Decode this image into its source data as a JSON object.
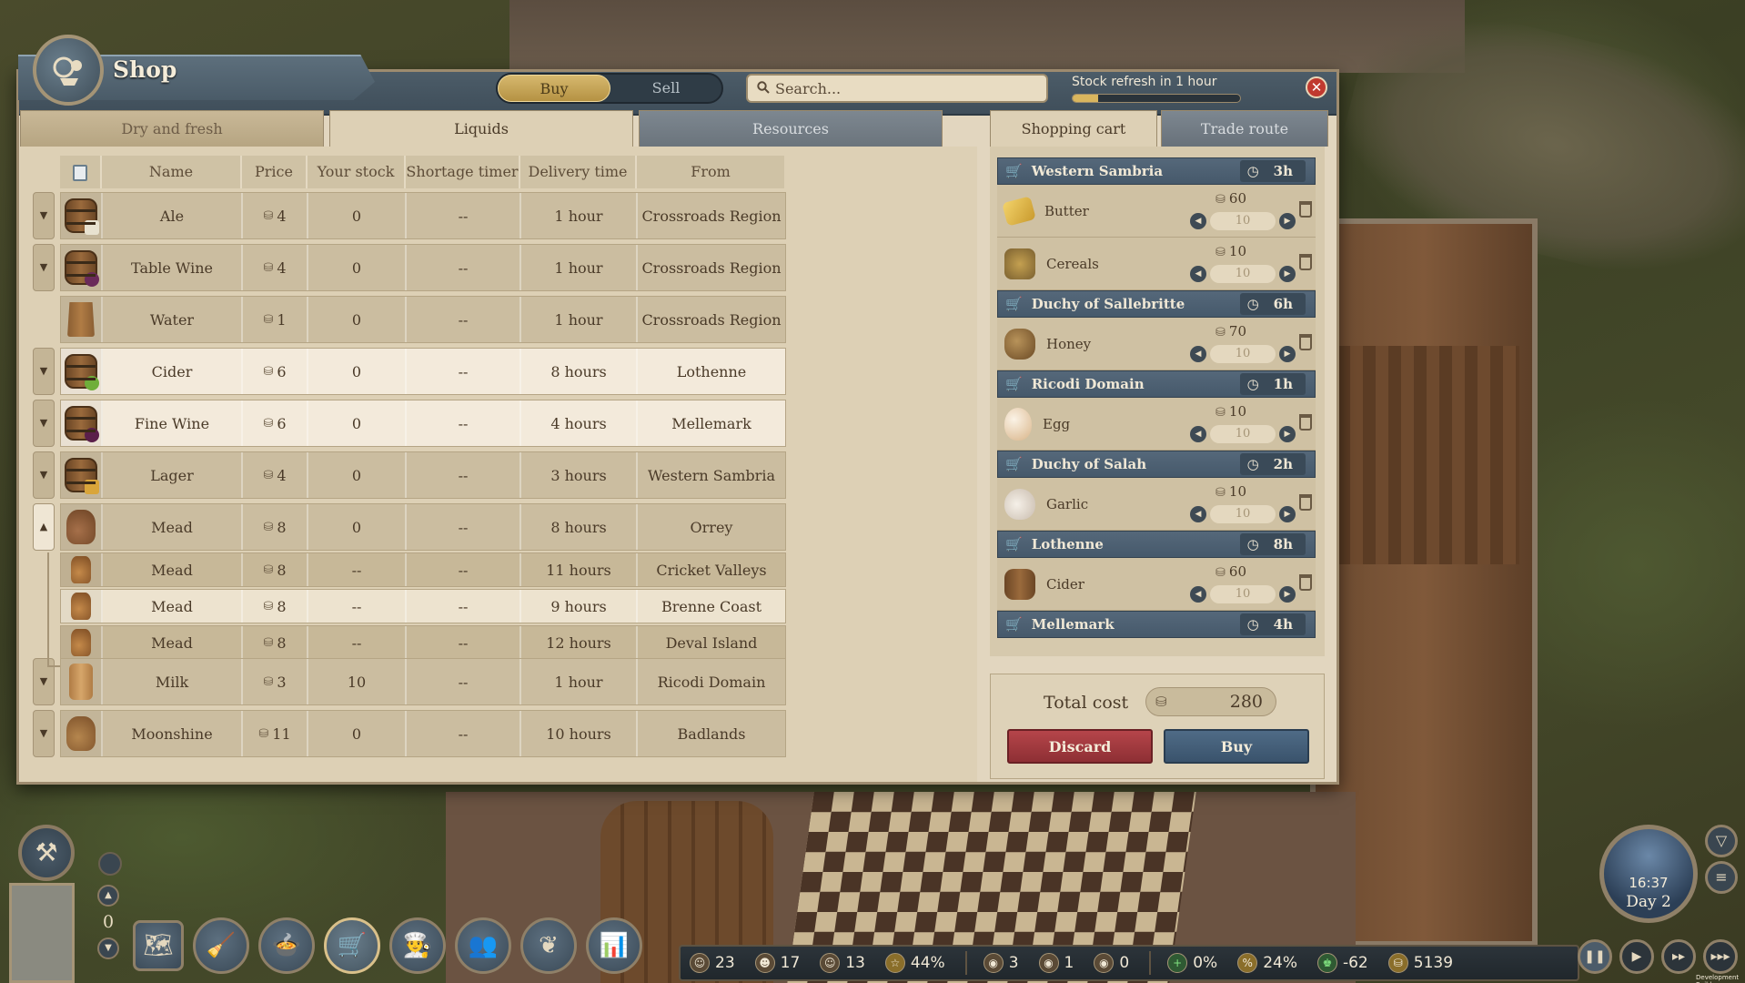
{
  "shop": {
    "title": "Shop",
    "mode_buy": "Buy",
    "mode_sell": "Sell",
    "search_placeholder": "Search...",
    "stock_refresh": "Stock refresh in 1 hour",
    "stock_refresh_progress": 0.15,
    "close_symbol": "✕"
  },
  "category_tabs": [
    "Dry and fresh",
    "Liquids",
    "Resources"
  ],
  "side_tabs": [
    "Shopping cart",
    "Trade route"
  ],
  "table": {
    "columns": [
      "Name",
      "Price",
      "Your stock",
      "Shortage timer",
      "Delivery time",
      "From"
    ],
    "rows": [
      {
        "name": "Ale",
        "price": "4",
        "stock": "0",
        "shortage": "--",
        "delivery": "1 hour",
        "from": "Crossroads Region"
      },
      {
        "name": "Table Wine",
        "price": "4",
        "stock": "0",
        "shortage": "--",
        "delivery": "1 hour",
        "from": "Crossroads Region"
      },
      {
        "name": "Water",
        "price": "1",
        "stock": "0",
        "shortage": "--",
        "delivery": "1 hour",
        "from": "Crossroads Region"
      },
      {
        "name": "Cider",
        "price": "6",
        "stock": "0",
        "shortage": "--",
        "delivery": "8 hours",
        "from": "Lothenne"
      },
      {
        "name": "Fine Wine",
        "price": "6",
        "stock": "0",
        "shortage": "--",
        "delivery": "4 hours",
        "from": "Mellemark"
      },
      {
        "name": "Lager",
        "price": "4",
        "stock": "0",
        "shortage": "--",
        "delivery": "3 hours",
        "from": "Western Sambria"
      },
      {
        "name": "Mead",
        "price": "8",
        "stock": "0",
        "shortage": "--",
        "delivery": "8 hours",
        "from": "Orrey"
      },
      {
        "name": "Mead",
        "price": "8",
        "stock": "--",
        "shortage": "--",
        "delivery": "11 hours",
        "from": "Cricket Valleys"
      },
      {
        "name": "Mead",
        "price": "8",
        "stock": "--",
        "shortage": "--",
        "delivery": "9 hours",
        "from": "Brenne Coast"
      },
      {
        "name": "Mead",
        "price": "8",
        "stock": "--",
        "shortage": "--",
        "delivery": "12 hours",
        "from": "Deval Island"
      },
      {
        "name": "Milk",
        "price": "3",
        "stock": "10",
        "shortage": "--",
        "delivery": "1 hour",
        "from": "Ricodi Domain"
      },
      {
        "name": "Moonshine",
        "price": "11",
        "stock": "0",
        "shortage": "--",
        "delivery": "10 hours",
        "from": "Badlands"
      }
    ]
  },
  "cart": {
    "groups": [
      {
        "region": "Western Sambria",
        "time": "3h",
        "items": [
          {
            "name": "Butter",
            "price": "60",
            "qty": "10"
          },
          {
            "name": "Cereals",
            "price": "10",
            "qty": "10"
          }
        ]
      },
      {
        "region": "Duchy of Sallebritte",
        "time": "6h",
        "items": [
          {
            "name": "Honey",
            "price": "70",
            "qty": "10"
          }
        ]
      },
      {
        "region": "Ricodi Domain",
        "time": "1h",
        "items": [
          {
            "name": "Egg",
            "price": "10",
            "qty": "10"
          }
        ]
      },
      {
        "region": "Duchy of Salah",
        "time": "2h",
        "items": [
          {
            "name": "Garlic",
            "price": "10",
            "qty": "10"
          }
        ]
      },
      {
        "region": "Lothenne",
        "time": "8h",
        "items": [
          {
            "name": "Cider",
            "price": "60",
            "qty": "10"
          }
        ]
      },
      {
        "region": "Mellemark",
        "time": "4h",
        "items": []
      }
    ],
    "total_label": "Total cost",
    "total_value": "280",
    "discard_label": "Discard",
    "buy_label": "Buy"
  },
  "hud": {
    "level": "0",
    "stats": [
      {
        "icon": "guests-icon",
        "value": "23"
      },
      {
        "icon": "workers-icon",
        "value": "17"
      },
      {
        "icon": "staff-icon",
        "value": "13"
      },
      {
        "icon": "satisfaction-icon",
        "value": "44%"
      },
      {
        "icon": "food-stock-icon",
        "value": "3"
      },
      {
        "icon": "drink-stock-icon",
        "value": "1"
      },
      {
        "icon": "misc-stock-icon",
        "value": "0"
      },
      {
        "icon": "growth-icon",
        "value": "0%"
      },
      {
        "icon": "tax-icon",
        "value": "24%"
      },
      {
        "icon": "reputation-icon",
        "value": "-62"
      },
      {
        "icon": "gold-icon",
        "value": "5139"
      }
    ],
    "clock_time": "16:37",
    "clock_day": "Day 2",
    "dev_build": "Development Build"
  },
  "colors": {
    "panel_bg": "#e2d6bf",
    "header_blue": "#4c5c68",
    "buy_gold": "#d6b86e",
    "discard_red": "#b5454a",
    "buy_blue": "#4f6b86"
  }
}
